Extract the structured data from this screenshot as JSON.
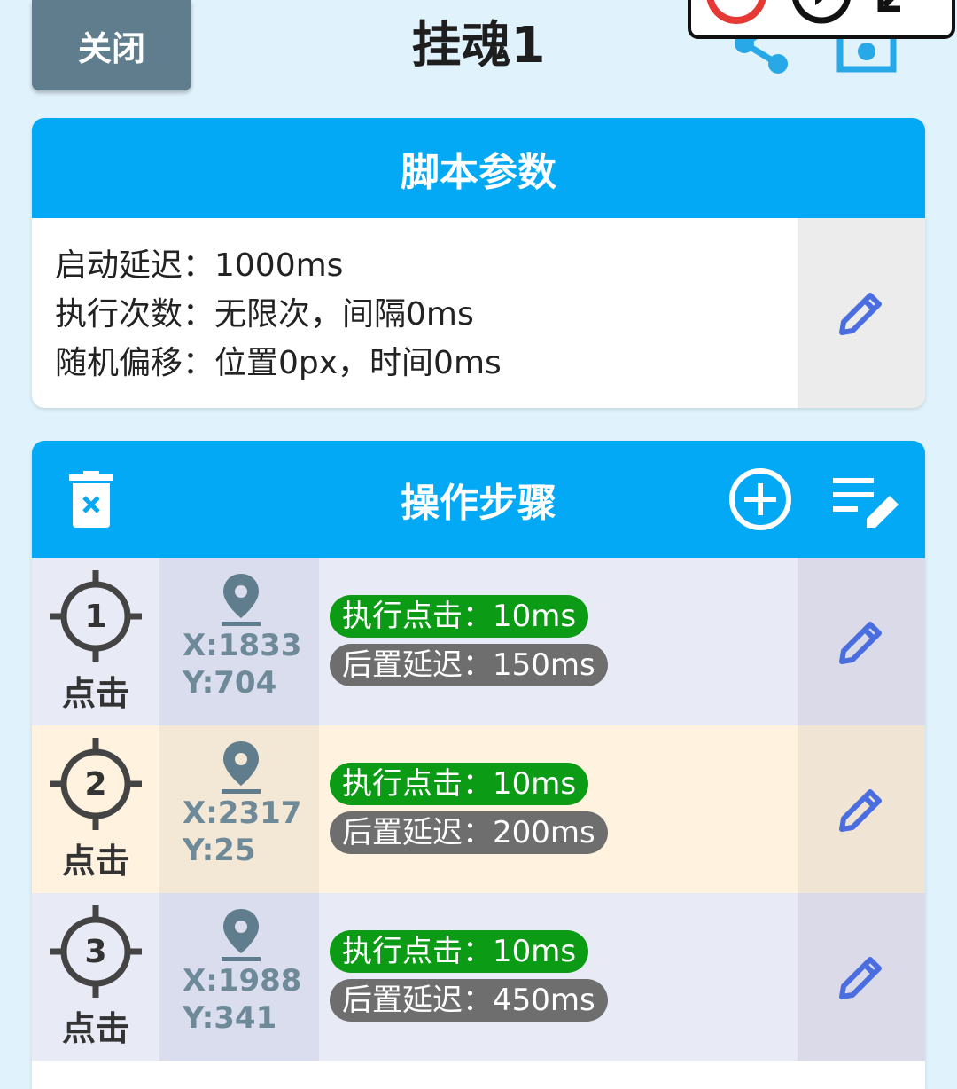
{
  "header": {
    "close_label": "关闭",
    "title": "挂魂1",
    "share_icon": "share-icon",
    "save_icon": "save-icon",
    "accent": "#03a9f4"
  },
  "params_card": {
    "title": "脚本参数",
    "lines": [
      "启动延迟：1000ms",
      "执行次数：无限次，间隔0ms",
      "随机偏移：位置0px，时间0ms"
    ]
  },
  "steps_card": {
    "title": "操作步骤",
    "steps": [
      {
        "index": "1",
        "type": "点击",
        "x": "X:1833",
        "y": "Y:704",
        "exec": "执行点击：10ms",
        "delay": "后置延迟：150ms"
      },
      {
        "index": "2",
        "type": "点击",
        "x": "X:2317",
        "y": "Y:25",
        "exec": "执行点击：10ms",
        "delay": "后置延迟：200ms"
      },
      {
        "index": "3",
        "type": "点击",
        "x": "X:1988",
        "y": "Y:341",
        "exec": "执行点击：10ms",
        "delay": "后置延迟：450ms"
      }
    ]
  }
}
